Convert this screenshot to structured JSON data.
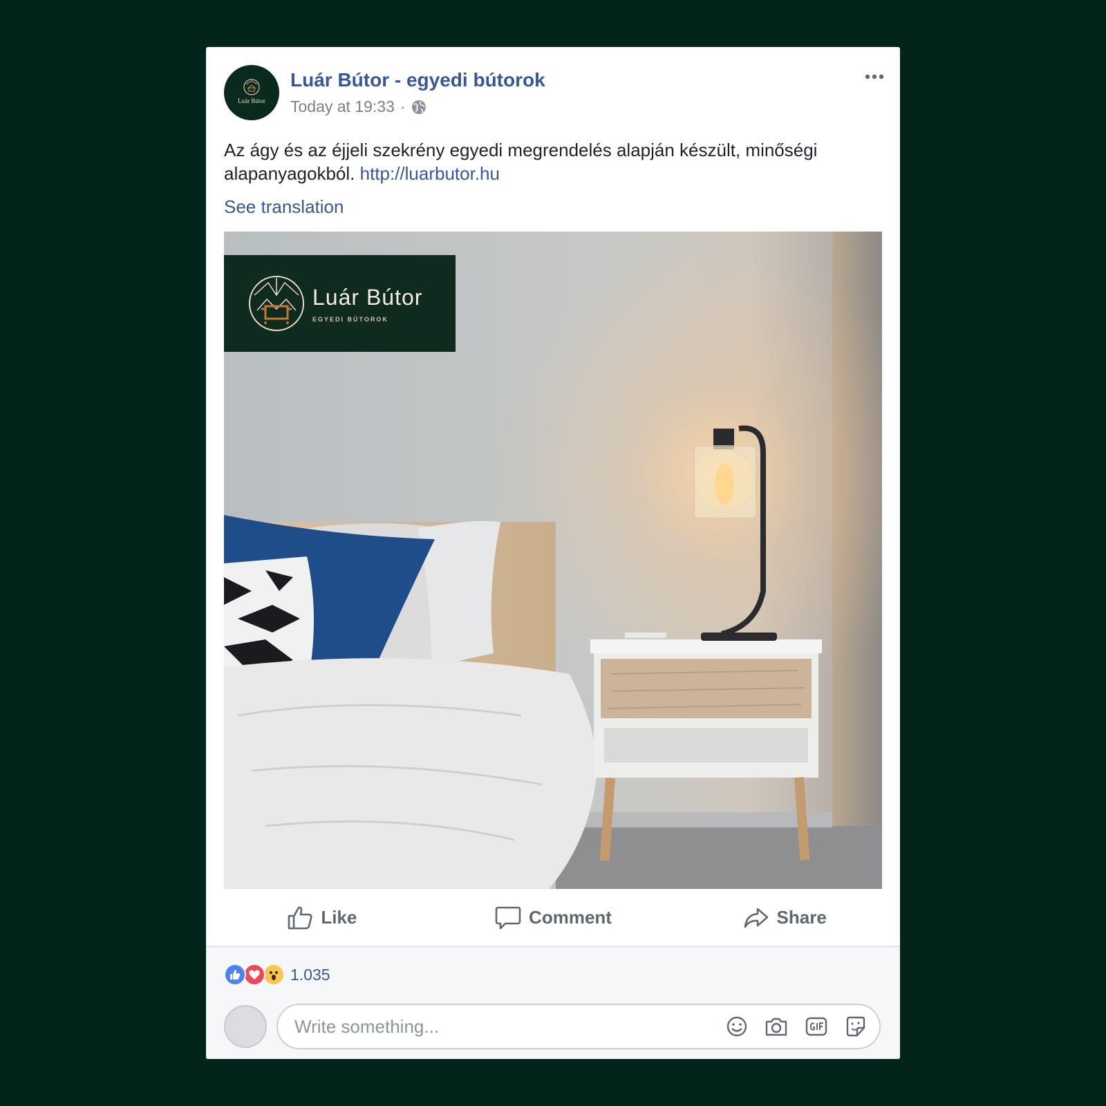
{
  "post": {
    "page_name": "Luár Bútor - egyedi bútorok",
    "timestamp": "Today at 19:33",
    "separator": "·",
    "text": "Az ágy és az éjjeli szekrény egyedi megrendelés alapján készült, minőségi alapanyagokból.",
    "link": "http://luarbutor.hu",
    "see_translation": "See translation"
  },
  "avatar": {
    "name": "Luár Bútor",
    "sub": "EGYEDI BÚTOROK"
  },
  "brand": {
    "title": "Luár Bútor",
    "subtitle": "EGYEDI BÚTOROK"
  },
  "actions": {
    "like": "Like",
    "comment": "Comment",
    "share": "Share"
  },
  "reactions": {
    "icons": [
      "like-reaction-icon",
      "love-reaction-icon",
      "wow-reaction-icon"
    ],
    "count": "1.035"
  },
  "comment": {
    "placeholder": "Write something...",
    "icons": [
      "emoji-icon",
      "camera-icon",
      "gif-icon",
      "sticker-icon"
    ]
  },
  "colors": {
    "background": "#02241a",
    "link": "#365899",
    "brand_box": "#0f2b20",
    "like_blue": "#4b82f3",
    "love_red": "#f0465a",
    "wow_yellow": "#f7c84b"
  }
}
